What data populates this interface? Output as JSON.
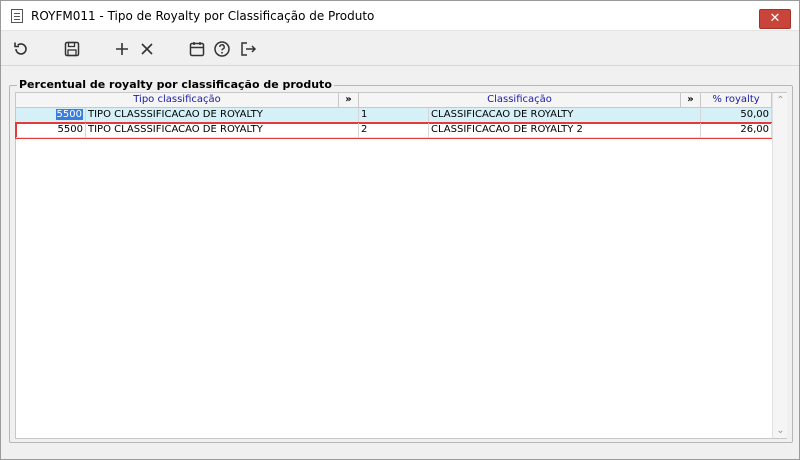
{
  "window": {
    "title": "ROYFM011 - Tipo de Royalty por Classificação de Produto",
    "close_glyph": "✕"
  },
  "toolbar": {
    "buttons": [
      {
        "name": "refresh-icon",
        "glyph": "↻"
      },
      {
        "name": "save-icon",
        "glyph": "💾"
      },
      {
        "name": "add-icon",
        "glyph": "+"
      },
      {
        "name": "delete-icon",
        "glyph": "✕"
      },
      {
        "name": "calendar-icon",
        "glyph": "📅"
      },
      {
        "name": "help-icon",
        "glyph": "?"
      },
      {
        "name": "exit-icon",
        "glyph": "⇥"
      }
    ]
  },
  "group": {
    "title": "Percentual de royalty por classificação de produto"
  },
  "grid": {
    "headers": {
      "tipo": "Tipo classificação",
      "expand1": "»",
      "classificacao": "Classificação",
      "expand2": "»",
      "royalty": "% royalty"
    },
    "rows": [
      {
        "codigo": "5500",
        "tipo": "TIPO CLASSSIFICACAO DE ROYALTY",
        "cod_class": "1",
        "classificacao": "CLASSIFICACAO DE ROYALTY",
        "royalty": "50,00"
      },
      {
        "codigo": "5500",
        "tipo": "TIPO CLASSSIFICACAO DE ROYALTY",
        "cod_class": "2",
        "classificacao": "CLASSIFICACAO DE ROYALTY 2",
        "royalty": "26,00"
      }
    ],
    "scroll_up": "⌃",
    "scroll_down": "⌄"
  },
  "colors": {
    "selected_row": "#d6f0f8",
    "current_row_border": "#e23a3a",
    "header_text": "#1a1aa6",
    "close_button": "#c9443a"
  }
}
